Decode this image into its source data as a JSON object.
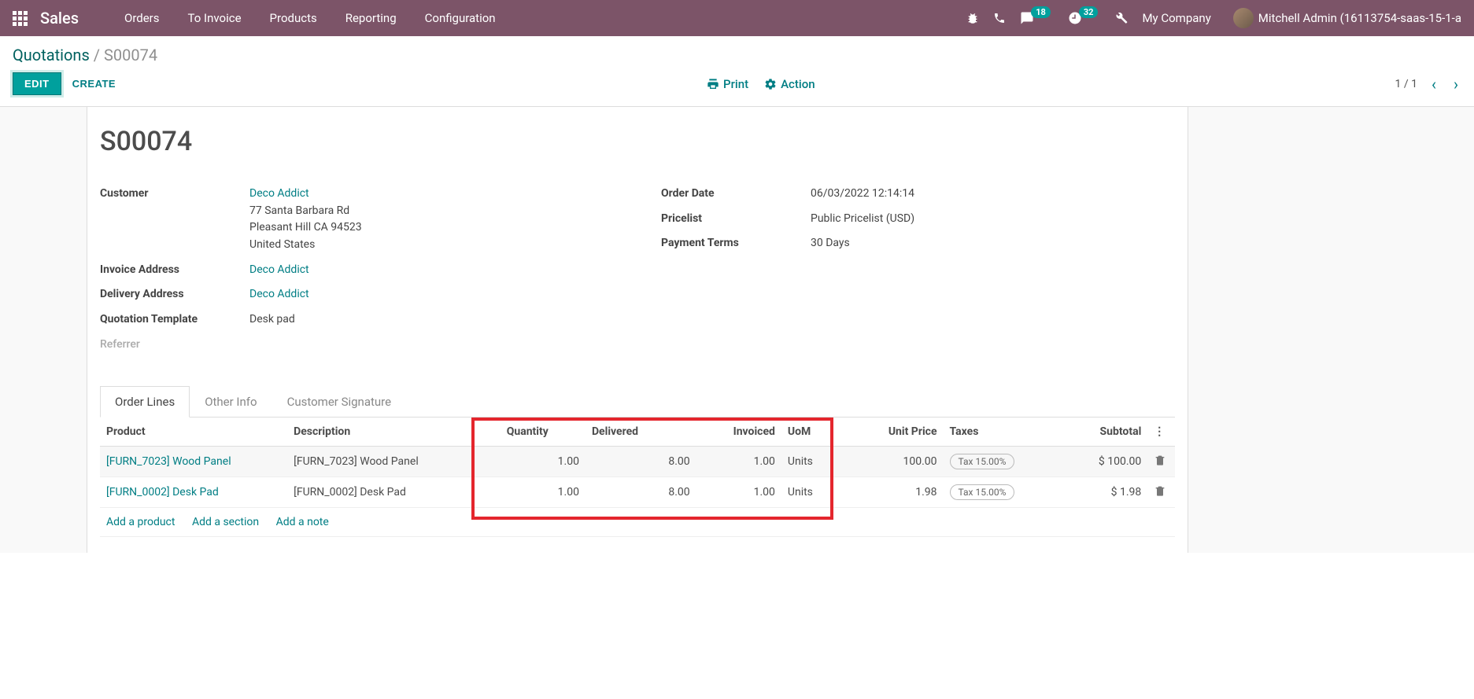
{
  "nav": {
    "brand": "Sales",
    "menu": [
      "Orders",
      "To Invoice",
      "Products",
      "Reporting",
      "Configuration"
    ],
    "messages_badge": "18",
    "activities_badge": "32",
    "company": "My Company",
    "user": "Mitchell Admin (16113754-saas-15-1-a"
  },
  "breadcrumb": {
    "parent": "Quotations",
    "current": "S00074"
  },
  "controls": {
    "edit": "EDIT",
    "create": "CREATE",
    "print": "Print",
    "action": "Action",
    "pager": "1 / 1"
  },
  "form": {
    "title": "S00074",
    "left": {
      "customer_label": "Customer",
      "customer_name": "Deco Addict",
      "customer_addr1": "77 Santa Barbara Rd",
      "customer_addr2": "Pleasant Hill CA 94523",
      "customer_addr3": "United States",
      "invoice_label": "Invoice Address",
      "invoice_value": "Deco Addict",
      "delivery_label": "Delivery Address",
      "delivery_value": "Deco Addict",
      "template_label": "Quotation Template",
      "template_value": "Desk pad",
      "referrer_label": "Referrer"
    },
    "right": {
      "date_label": "Order Date",
      "date_value": "06/03/2022 12:14:14",
      "pricelist_label": "Pricelist",
      "pricelist_value": "Public Pricelist (USD)",
      "terms_label": "Payment Terms",
      "terms_value": "30 Days"
    }
  },
  "tabs": [
    "Order Lines",
    "Other Info",
    "Customer Signature"
  ],
  "table": {
    "headers": {
      "product": "Product",
      "description": "Description",
      "quantity": "Quantity",
      "delivered": "Delivered",
      "invoiced": "Invoiced",
      "uom": "UoM",
      "unit_price": "Unit Price",
      "taxes": "Taxes",
      "subtotal": "Subtotal"
    },
    "rows": [
      {
        "product": "[FURN_7023] Wood Panel",
        "description": "[FURN_7023] Wood Panel",
        "quantity": "1.00",
        "delivered": "8.00",
        "invoiced": "1.00",
        "uom": "Units",
        "unit_price": "100.00",
        "tax": "Tax 15.00%",
        "subtotal": "$ 100.00"
      },
      {
        "product": "[FURN_0002] Desk Pad",
        "description": "[FURN_0002] Desk Pad",
        "quantity": "1.00",
        "delivered": "8.00",
        "invoiced": "1.00",
        "uom": "Units",
        "unit_price": "1.98",
        "tax": "Tax 15.00%",
        "subtotal": "$ 1.98"
      }
    ],
    "add_product": "Add a product",
    "add_section": "Add a section",
    "add_note": "Add a note"
  }
}
